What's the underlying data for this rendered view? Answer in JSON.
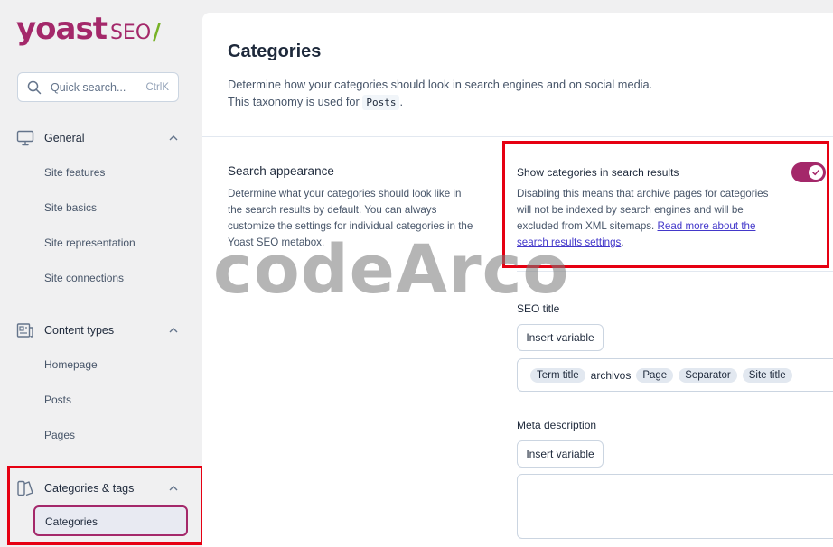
{
  "brand": {
    "name": "yoast",
    "product": "SEO",
    "accent": "#a4286a",
    "slash_color": "#77b227"
  },
  "search": {
    "placeholder": "Quick search...",
    "shortcut": "CtrlK"
  },
  "sidebar": {
    "groups": [
      {
        "label": "General",
        "icon": "desktop-icon",
        "expanded": true,
        "items": [
          "Site features",
          "Site basics",
          "Site representation",
          "Site connections"
        ]
      },
      {
        "label": "Content types",
        "icon": "newspaper-icon",
        "expanded": true,
        "items": [
          "Homepage",
          "Posts",
          "Pages"
        ]
      },
      {
        "label": "Categories & tags",
        "icon": "tag-icon",
        "expanded": true,
        "items": [
          "Categories"
        ],
        "active_item": "Categories"
      }
    ]
  },
  "page": {
    "title": "Categories",
    "desc_line1": "Determine how your categories should look in search engines and on social media.",
    "desc_line2_prefix": "This taxonomy is used for ",
    "desc_code": "Posts",
    "desc_line2_suffix": "."
  },
  "search_appearance": {
    "title": "Search appearance",
    "description": "Determine what your categories should look like in the search results by default. You can always customize the settings for individual categories in the Yoast SEO metabox."
  },
  "toggle": {
    "label": "Show categories in search results",
    "enabled": true,
    "description": "Disabling this means that archive pages for categories will not be indexed by search engines and will be excluded from XML sitemaps. ",
    "link_text": "Read more about the search results settings",
    "after_link": "."
  },
  "seo_title": {
    "label": "SEO title",
    "button": "Insert variable",
    "tokens": [
      {
        "text": "Term title",
        "pill": true
      },
      {
        "text": "archivos",
        "pill": false
      },
      {
        "text": "Page",
        "pill": true
      },
      {
        "text": "Separator",
        "pill": true
      },
      {
        "text": "Site title",
        "pill": true
      }
    ]
  },
  "meta_description": {
    "label": "Meta description",
    "button": "Insert variable",
    "value": ""
  },
  "watermark": "codeArco"
}
